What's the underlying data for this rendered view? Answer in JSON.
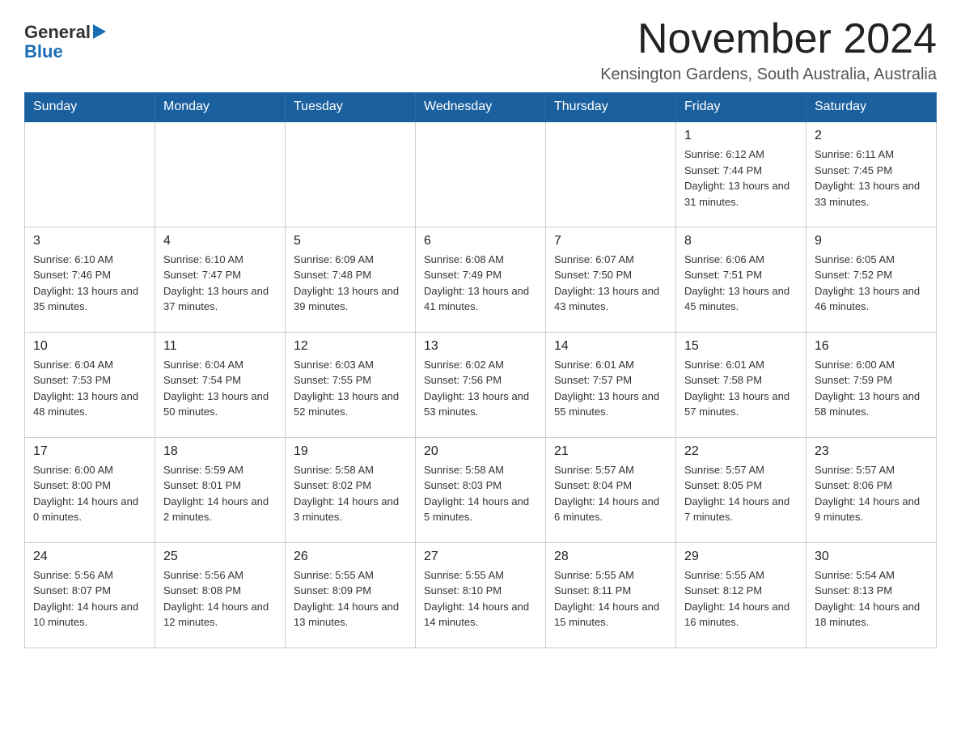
{
  "header": {
    "logo": {
      "text_general": "General",
      "text_blue": "Blue",
      "triangle": "▶"
    },
    "title": "November 2024",
    "subtitle": "Kensington Gardens, South Australia, Australia"
  },
  "days_of_week": [
    "Sunday",
    "Monday",
    "Tuesday",
    "Wednesday",
    "Thursday",
    "Friday",
    "Saturday"
  ],
  "weeks": [
    [
      {
        "day": "",
        "sunrise": "",
        "sunset": "",
        "daylight": ""
      },
      {
        "day": "",
        "sunrise": "",
        "sunset": "",
        "daylight": ""
      },
      {
        "day": "",
        "sunrise": "",
        "sunset": "",
        "daylight": ""
      },
      {
        "day": "",
        "sunrise": "",
        "sunset": "",
        "daylight": ""
      },
      {
        "day": "",
        "sunrise": "",
        "sunset": "",
        "daylight": ""
      },
      {
        "day": "1",
        "sunrise": "Sunrise: 6:12 AM",
        "sunset": "Sunset: 7:44 PM",
        "daylight": "Daylight: 13 hours and 31 minutes."
      },
      {
        "day": "2",
        "sunrise": "Sunrise: 6:11 AM",
        "sunset": "Sunset: 7:45 PM",
        "daylight": "Daylight: 13 hours and 33 minutes."
      }
    ],
    [
      {
        "day": "3",
        "sunrise": "Sunrise: 6:10 AM",
        "sunset": "Sunset: 7:46 PM",
        "daylight": "Daylight: 13 hours and 35 minutes."
      },
      {
        "day": "4",
        "sunrise": "Sunrise: 6:10 AM",
        "sunset": "Sunset: 7:47 PM",
        "daylight": "Daylight: 13 hours and 37 minutes."
      },
      {
        "day": "5",
        "sunrise": "Sunrise: 6:09 AM",
        "sunset": "Sunset: 7:48 PM",
        "daylight": "Daylight: 13 hours and 39 minutes."
      },
      {
        "day": "6",
        "sunrise": "Sunrise: 6:08 AM",
        "sunset": "Sunset: 7:49 PM",
        "daylight": "Daylight: 13 hours and 41 minutes."
      },
      {
        "day": "7",
        "sunrise": "Sunrise: 6:07 AM",
        "sunset": "Sunset: 7:50 PM",
        "daylight": "Daylight: 13 hours and 43 minutes."
      },
      {
        "day": "8",
        "sunrise": "Sunrise: 6:06 AM",
        "sunset": "Sunset: 7:51 PM",
        "daylight": "Daylight: 13 hours and 45 minutes."
      },
      {
        "day": "9",
        "sunrise": "Sunrise: 6:05 AM",
        "sunset": "Sunset: 7:52 PM",
        "daylight": "Daylight: 13 hours and 46 minutes."
      }
    ],
    [
      {
        "day": "10",
        "sunrise": "Sunrise: 6:04 AM",
        "sunset": "Sunset: 7:53 PM",
        "daylight": "Daylight: 13 hours and 48 minutes."
      },
      {
        "day": "11",
        "sunrise": "Sunrise: 6:04 AM",
        "sunset": "Sunset: 7:54 PM",
        "daylight": "Daylight: 13 hours and 50 minutes."
      },
      {
        "day": "12",
        "sunrise": "Sunrise: 6:03 AM",
        "sunset": "Sunset: 7:55 PM",
        "daylight": "Daylight: 13 hours and 52 minutes."
      },
      {
        "day": "13",
        "sunrise": "Sunrise: 6:02 AM",
        "sunset": "Sunset: 7:56 PM",
        "daylight": "Daylight: 13 hours and 53 minutes."
      },
      {
        "day": "14",
        "sunrise": "Sunrise: 6:01 AM",
        "sunset": "Sunset: 7:57 PM",
        "daylight": "Daylight: 13 hours and 55 minutes."
      },
      {
        "day": "15",
        "sunrise": "Sunrise: 6:01 AM",
        "sunset": "Sunset: 7:58 PM",
        "daylight": "Daylight: 13 hours and 57 minutes."
      },
      {
        "day": "16",
        "sunrise": "Sunrise: 6:00 AM",
        "sunset": "Sunset: 7:59 PM",
        "daylight": "Daylight: 13 hours and 58 minutes."
      }
    ],
    [
      {
        "day": "17",
        "sunrise": "Sunrise: 6:00 AM",
        "sunset": "Sunset: 8:00 PM",
        "daylight": "Daylight: 14 hours and 0 minutes."
      },
      {
        "day": "18",
        "sunrise": "Sunrise: 5:59 AM",
        "sunset": "Sunset: 8:01 PM",
        "daylight": "Daylight: 14 hours and 2 minutes."
      },
      {
        "day": "19",
        "sunrise": "Sunrise: 5:58 AM",
        "sunset": "Sunset: 8:02 PM",
        "daylight": "Daylight: 14 hours and 3 minutes."
      },
      {
        "day": "20",
        "sunrise": "Sunrise: 5:58 AM",
        "sunset": "Sunset: 8:03 PM",
        "daylight": "Daylight: 14 hours and 5 minutes."
      },
      {
        "day": "21",
        "sunrise": "Sunrise: 5:57 AM",
        "sunset": "Sunset: 8:04 PM",
        "daylight": "Daylight: 14 hours and 6 minutes."
      },
      {
        "day": "22",
        "sunrise": "Sunrise: 5:57 AM",
        "sunset": "Sunset: 8:05 PM",
        "daylight": "Daylight: 14 hours and 7 minutes."
      },
      {
        "day": "23",
        "sunrise": "Sunrise: 5:57 AM",
        "sunset": "Sunset: 8:06 PM",
        "daylight": "Daylight: 14 hours and 9 minutes."
      }
    ],
    [
      {
        "day": "24",
        "sunrise": "Sunrise: 5:56 AM",
        "sunset": "Sunset: 8:07 PM",
        "daylight": "Daylight: 14 hours and 10 minutes."
      },
      {
        "day": "25",
        "sunrise": "Sunrise: 5:56 AM",
        "sunset": "Sunset: 8:08 PM",
        "daylight": "Daylight: 14 hours and 12 minutes."
      },
      {
        "day": "26",
        "sunrise": "Sunrise: 5:55 AM",
        "sunset": "Sunset: 8:09 PM",
        "daylight": "Daylight: 14 hours and 13 minutes."
      },
      {
        "day": "27",
        "sunrise": "Sunrise: 5:55 AM",
        "sunset": "Sunset: 8:10 PM",
        "daylight": "Daylight: 14 hours and 14 minutes."
      },
      {
        "day": "28",
        "sunrise": "Sunrise: 5:55 AM",
        "sunset": "Sunset: 8:11 PM",
        "daylight": "Daylight: 14 hours and 15 minutes."
      },
      {
        "day": "29",
        "sunrise": "Sunrise: 5:55 AM",
        "sunset": "Sunset: 8:12 PM",
        "daylight": "Daylight: 14 hours and 16 minutes."
      },
      {
        "day": "30",
        "sunrise": "Sunrise: 5:54 AM",
        "sunset": "Sunset: 8:13 PM",
        "daylight": "Daylight: 14 hours and 18 minutes."
      }
    ]
  ]
}
